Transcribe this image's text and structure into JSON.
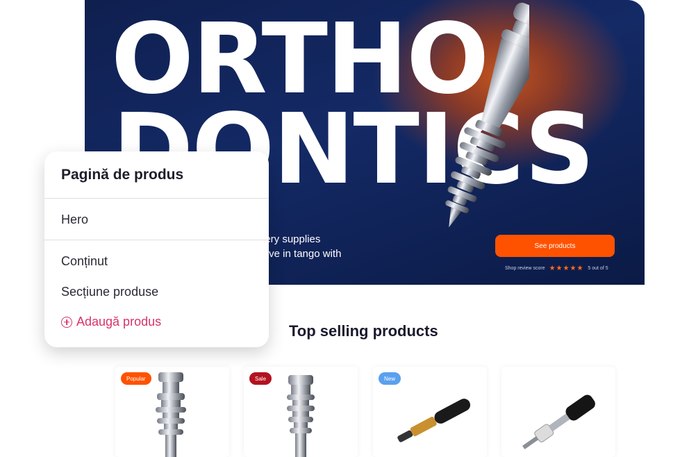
{
  "hero": {
    "title_line1": "ORTHO",
    "title_line2": "DONTICS",
    "subtitle_line1": "rgery supplies",
    "subtitle_line2": "volve in tango with",
    "cta_label": "See products",
    "review_label": "Shop review score",
    "review_stars": "★★★★★",
    "review_score": "5 out of 5",
    "colors": {
      "cta": "#ff5200",
      "background": "#142a66",
      "stars": "#ff6a1a"
    }
  },
  "section": {
    "title": "Top selling products"
  },
  "products": [
    {
      "badge": "Popular",
      "badge_color": "#ff5200",
      "icon": "ortho-screw-icon"
    },
    {
      "badge": "Sale",
      "badge_color": "#b3121f",
      "icon": "ortho-screw-icon"
    },
    {
      "badge": "New",
      "badge_color": "#5aa0ee",
      "icon": "screwdriver-icon"
    },
    {
      "badge": "",
      "badge_color": "",
      "icon": "driver-tool-icon"
    }
  ],
  "panel": {
    "title": "Pagină de produs",
    "items": [
      "Hero",
      "Conținut",
      "Secțiune produse"
    ],
    "add_label": "Adaugă produs",
    "accent": "#d6336c"
  }
}
